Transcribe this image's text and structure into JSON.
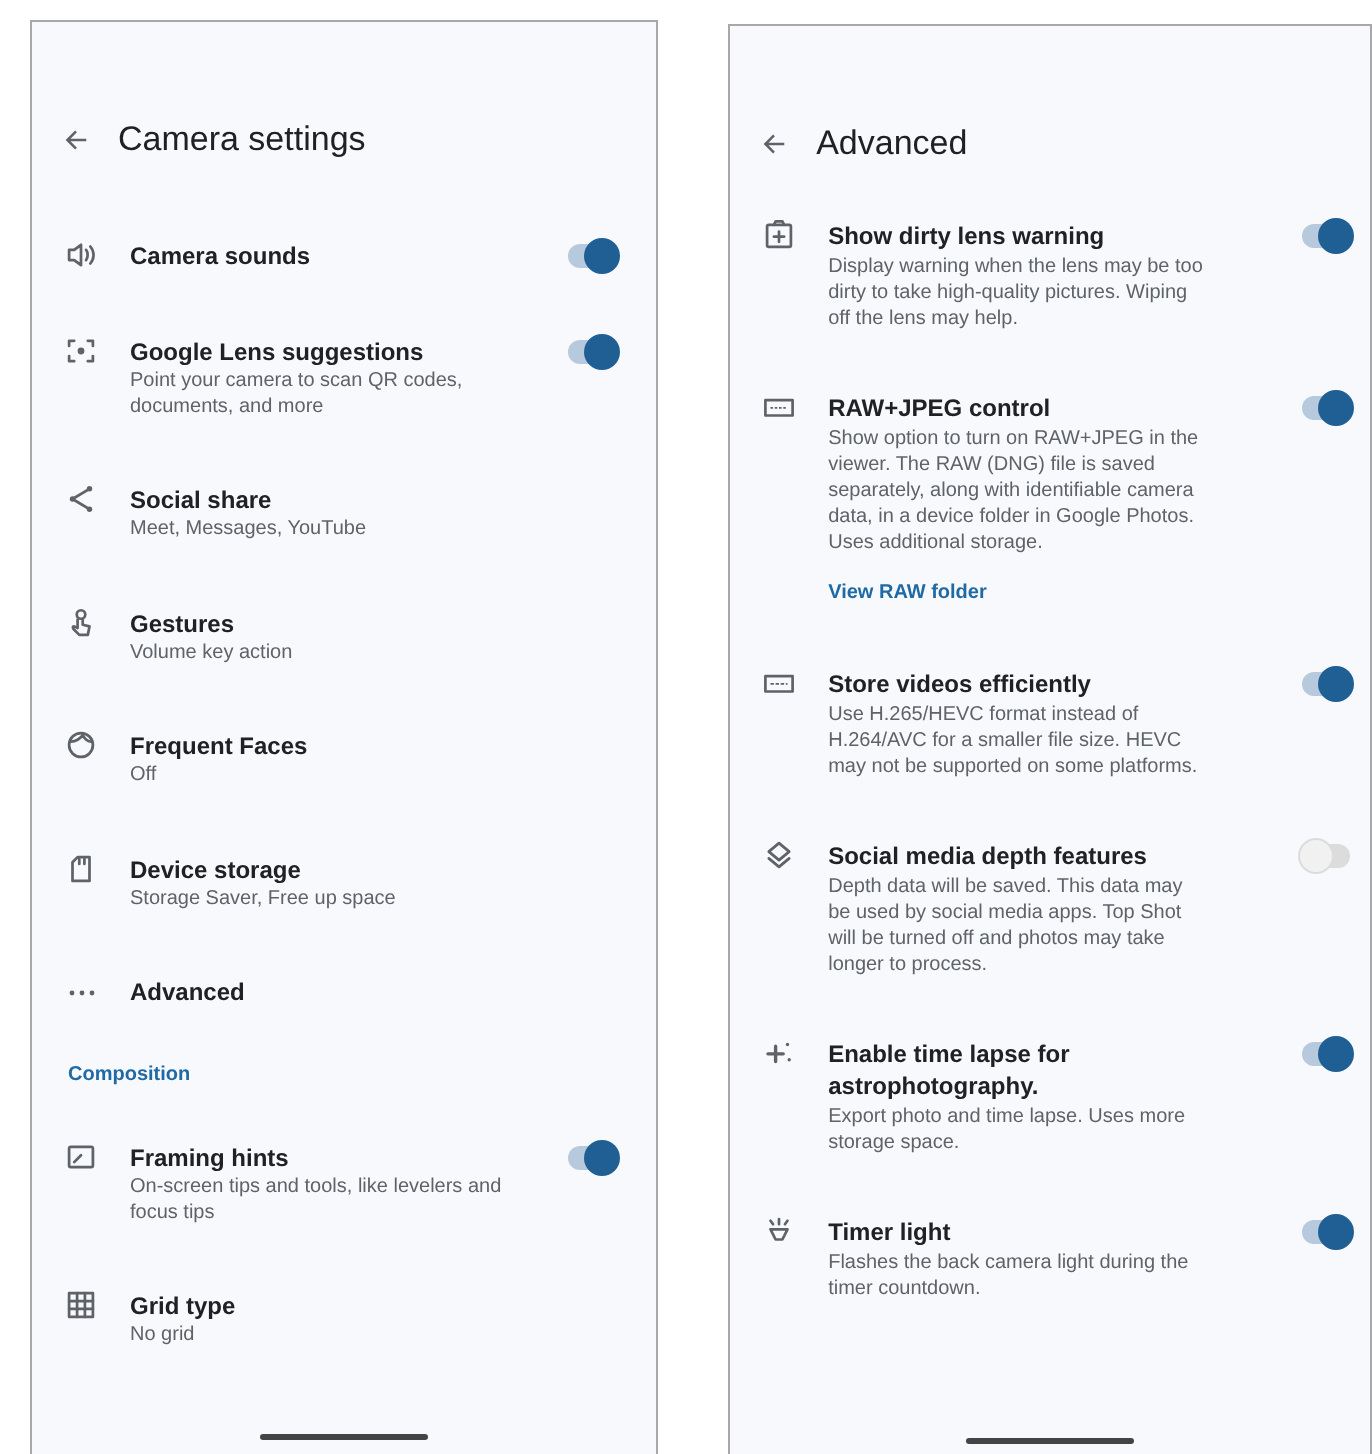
{
  "screens": [
    {
      "title": "Camera settings",
      "items": [
        {
          "kind": "switch",
          "title": "Camera sounds",
          "on": true
        },
        {
          "kind": "switch",
          "title": "Google Lens suggestions",
          "subtitle": "Point your camera to scan QR codes, documents, and more",
          "on": true
        },
        {
          "kind": "link",
          "title": "Social share",
          "subtitle": "Meet, Messages, YouTube"
        },
        {
          "kind": "link",
          "title": "Gestures",
          "subtitle": "Volume key action"
        },
        {
          "kind": "link",
          "title": "Frequent Faces",
          "subtitle": "Off"
        },
        {
          "kind": "link",
          "title": "Device storage",
          "subtitle": "Storage Saver, Free up space"
        },
        {
          "kind": "link",
          "title": "Advanced"
        }
      ],
      "sections": [
        {
          "title": "Composition",
          "items": [
            {
              "kind": "switch",
              "title": "Framing hints",
              "subtitle": "On-screen tips and tools, like levelers and focus tips",
              "on": true
            },
            {
              "kind": "link",
              "title": "Grid type",
              "subtitle": "No grid"
            }
          ]
        }
      ]
    },
    {
      "title": "Advanced",
      "items": [
        {
          "kind": "switch",
          "title": "Show dirty lens warning",
          "subtitle": "Display warning when the lens may be too dirty to take high-quality pictures. Wiping off the lens may help.",
          "on": true
        },
        {
          "kind": "switch",
          "title": "RAW+JPEG control",
          "subtitle": "Show option to turn on RAW+JPEG in the viewer. The RAW (DNG) file is saved separately, along with identifiable camera data, in a device folder in Google Photos. Uses additional storage.",
          "link": "View RAW folder",
          "on": true
        },
        {
          "kind": "switch",
          "title": "Store videos efficiently",
          "subtitle": "Use H.265/HEVC format instead of H.264/AVC for a smaller file size. HEVC may not be supported on some platforms.",
          "on": true
        },
        {
          "kind": "switch",
          "title": "Social media depth features",
          "subtitle": "Depth data will be saved. This data may be used by social media apps. Top Shot will be turned off and photos may take longer to process.",
          "on": false
        },
        {
          "kind": "switch",
          "title": "Enable time lapse for astrophotography.",
          "subtitle": "Export photo and time lapse. Uses more storage space.",
          "on": true
        },
        {
          "kind": "switch",
          "title": "Timer light",
          "subtitle": "Flashes the back camera light during the timer countdown.",
          "on": true
        }
      ]
    }
  ]
}
